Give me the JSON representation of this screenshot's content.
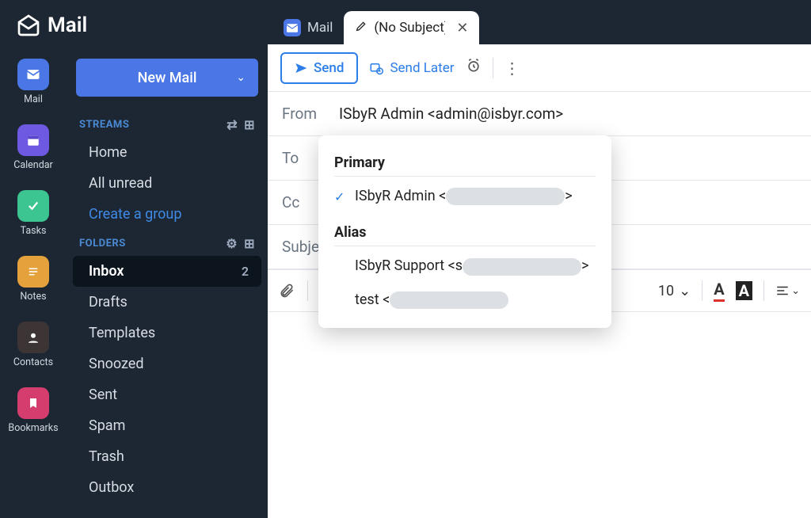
{
  "brand": "Mail",
  "rail": [
    {
      "label": "Mail"
    },
    {
      "label": "Calendar"
    },
    {
      "label": "Tasks"
    },
    {
      "label": "Notes"
    },
    {
      "label": "Contacts"
    },
    {
      "label": "Bookmarks"
    }
  ],
  "sidebar": {
    "new_mail": "New Mail",
    "streams_header": "STREAMS",
    "streams": [
      {
        "label": "Home"
      },
      {
        "label": "All unread"
      },
      {
        "label": "Create a group"
      }
    ],
    "folders_header": "FOLDERS",
    "folders": [
      {
        "label": "Inbox",
        "badge": "2"
      },
      {
        "label": "Drafts"
      },
      {
        "label": "Templates"
      },
      {
        "label": "Snoozed"
      },
      {
        "label": "Sent"
      },
      {
        "label": "Spam"
      },
      {
        "label": "Trash"
      },
      {
        "label": "Outbox"
      }
    ]
  },
  "tabs": {
    "inactive": "Mail",
    "active": "(No Subject)"
  },
  "toolbar": {
    "send": "Send",
    "send_later": "Send Later"
  },
  "fields": {
    "from_label": "From",
    "from_value": "ISbyR Admin <admin@isbyr.com>",
    "to_label": "To",
    "cc_label": "Cc",
    "subject_label": "Subject"
  },
  "format": {
    "font_size": "10"
  },
  "from_dropdown": {
    "primary_header": "Primary",
    "primary_prefix": "ISbyR Admin <",
    "primary_suffix": ">",
    "alias_header": "Alias",
    "alias1_prefix": "ISbyR Support <s",
    "alias1_suffix": ">",
    "alias2_prefix": "test <"
  }
}
